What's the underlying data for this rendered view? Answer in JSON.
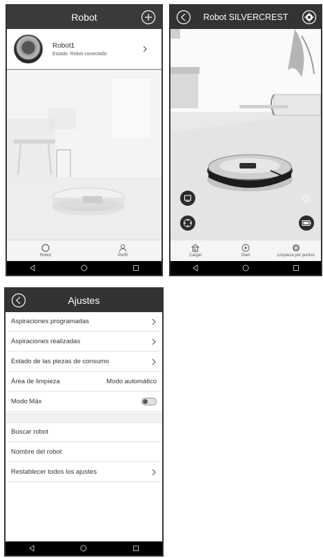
{
  "screen1": {
    "title": "Robot",
    "robot_name": "Robot1",
    "robot_status": "Estado: Robot conectado",
    "tabs": [
      {
        "label": "Robot"
      },
      {
        "label": "Perfil"
      }
    ]
  },
  "screen2": {
    "title": "Robot SILVERCREST",
    "actions": [
      {
        "label": "Cargar"
      },
      {
        "label": "Start"
      },
      {
        "label": "Limpieza por puntos"
      }
    ]
  },
  "screen3": {
    "title": "Ajustes",
    "rows": [
      {
        "label": "Aspiraciones programadas"
      },
      {
        "label": "Aspiraciones realizadas"
      },
      {
        "label": "Estado de las piezas de consumo"
      },
      {
        "label": "Área de limpieza",
        "value": "Modo automático"
      },
      {
        "label": "Modo Máx"
      },
      {
        "label": "Buscar robot"
      },
      {
        "label": "Nombre del robot"
      },
      {
        "label": "Restablecer todos los ajustes"
      }
    ]
  },
  "colors": {
    "header": "#3a3a3a",
    "navbar": "#000000",
    "accent_dark": "#2b2b2b"
  },
  "icons": [
    "plus-circle-icon",
    "chevron-right-icon",
    "back-icon",
    "gear-icon",
    "home-icon",
    "play-icon",
    "spot-icon",
    "user-icon",
    "nav-back-icon",
    "nav-home-icon",
    "nav-recent-icon",
    "toggle-icon"
  ]
}
